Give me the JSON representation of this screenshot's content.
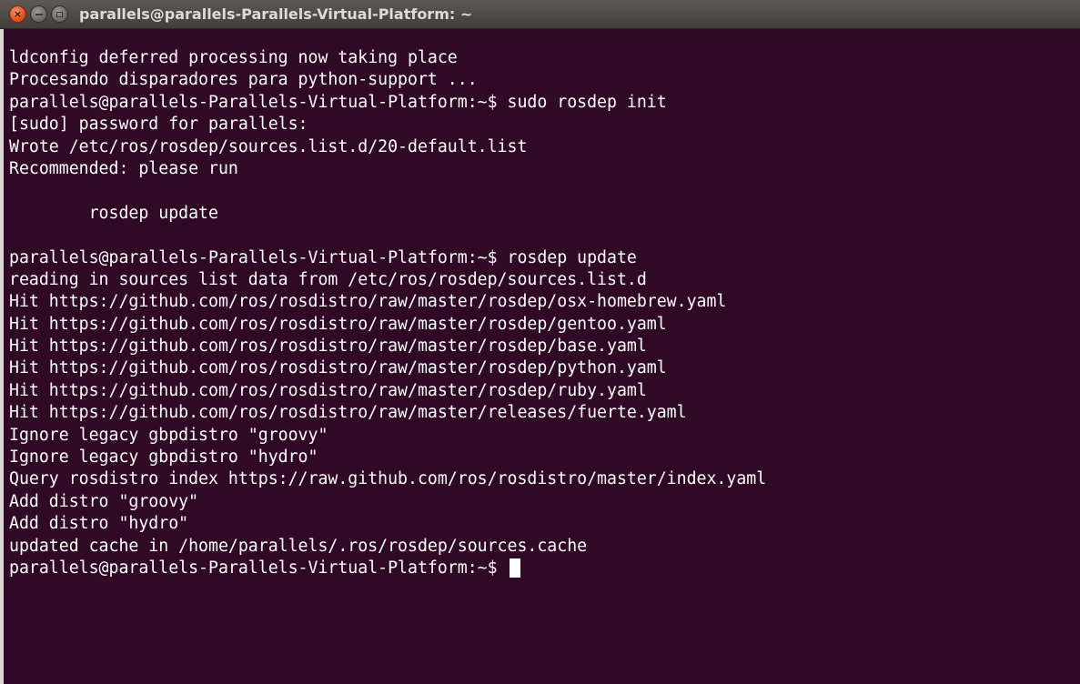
{
  "window": {
    "title": "parallels@parallels-Parallels-Virtual-Platform: ~",
    "close_glyph": "×"
  },
  "terminal": {
    "lines": [
      "ldconfig deferred processing now taking place",
      "Procesando disparadores para python-support ...",
      "parallels@parallels-Parallels-Virtual-Platform:~$ sudo rosdep init",
      "[sudo] password for parallels:",
      "Wrote /etc/ros/rosdep/sources.list.d/20-default.list",
      "Recommended: please run",
      "",
      "        rosdep update",
      "",
      "parallels@parallels-Parallels-Virtual-Platform:~$ rosdep update",
      "reading in sources list data from /etc/ros/rosdep/sources.list.d",
      "Hit https://github.com/ros/rosdistro/raw/master/rosdep/osx-homebrew.yaml",
      "Hit https://github.com/ros/rosdistro/raw/master/rosdep/gentoo.yaml",
      "Hit https://github.com/ros/rosdistro/raw/master/rosdep/base.yaml",
      "Hit https://github.com/ros/rosdistro/raw/master/rosdep/python.yaml",
      "Hit https://github.com/ros/rosdistro/raw/master/rosdep/ruby.yaml",
      "Hit https://github.com/ros/rosdistro/raw/master/releases/fuerte.yaml",
      "Ignore legacy gbpdistro \"groovy\"",
      "Ignore legacy gbpdistro \"hydro\"",
      "Query rosdistro index https://raw.github.com/ros/rosdistro/master/index.yaml",
      "Add distro \"groovy\"",
      "Add distro \"hydro\"",
      "updated cache in /home/parallels/.ros/rosdep/sources.cache"
    ],
    "prompt": "parallels@parallels-Parallels-Virtual-Platform:~$ "
  },
  "colors": {
    "background": "#300a24",
    "text": "#ffffff",
    "close_button": "#e2501e",
    "titlebar": "#4c4b47"
  }
}
